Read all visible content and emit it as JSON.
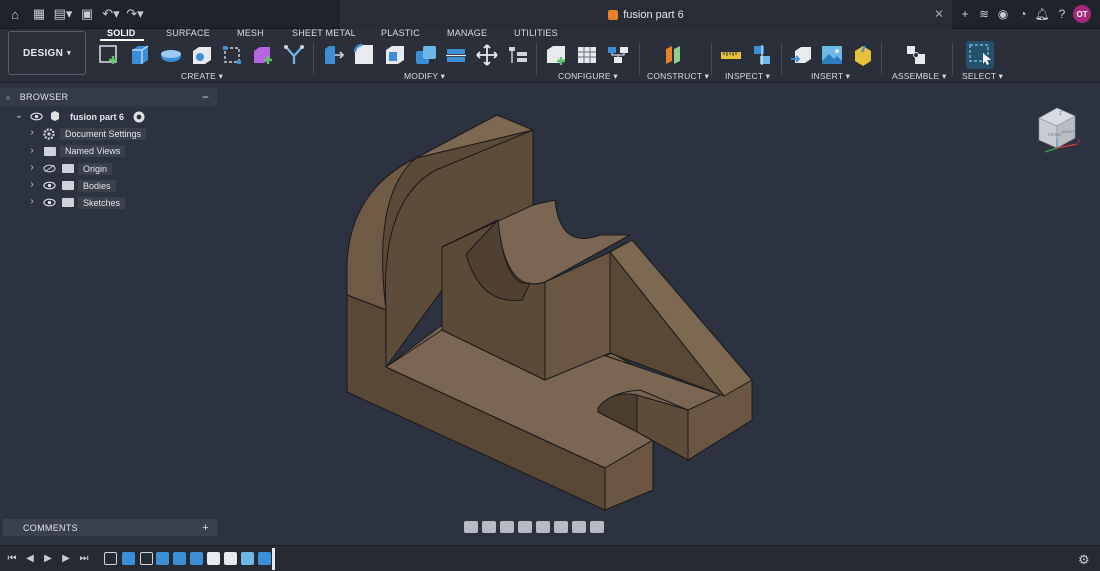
{
  "app": {
    "doc_title": "fusion part 6",
    "user_initials": "OT"
  },
  "ribbon": {
    "workspace": "DESIGN",
    "tabs": [
      "SOLID",
      "SURFACE",
      "MESH",
      "SHEET METAL",
      "PLASTIC",
      "MANAGE",
      "UTILITIES"
    ],
    "active_tab": "SOLID",
    "groups": {
      "create": "CREATE",
      "modify": "MODIFY",
      "configure": "CONFIGURE",
      "construct": "CONSTRUCT",
      "inspect": "INSPECT",
      "insert": "INSERT",
      "assemble": "ASSEMBLE",
      "select": "SELECT"
    }
  },
  "browser": {
    "title": "BROWSER",
    "root": "fusion part 6",
    "items": [
      "Document Settings",
      "Named Views",
      "Origin",
      "Bodies",
      "Sketches"
    ]
  },
  "comments": {
    "title": "COMMENTS"
  },
  "viewcube": {
    "face_front": "FRONT",
    "face_right": "RIGHT",
    "axis_z": "Z",
    "axis_x": "X"
  },
  "colors": {
    "part": "#6e5a45",
    "accent_select": "#2f8fb8",
    "avatar": "#a3297a"
  }
}
